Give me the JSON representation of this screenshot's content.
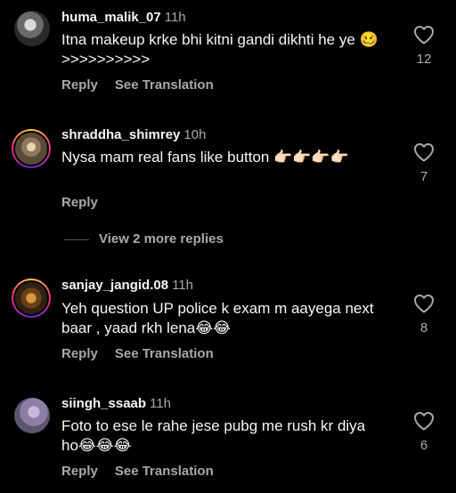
{
  "colors": {
    "background": "#000000",
    "primary_text": "#f5f5f5",
    "secondary_text": "#a8a8a8"
  },
  "comments": [
    {
      "username": "huma_malik_07",
      "time": "11h",
      "text": "Itna makeup krke bhi kitni gandi dikhti he ye 🥴>>>>>>>>>>",
      "likes": "12",
      "reply_label": "Reply",
      "translation_label": "See Translation",
      "avatar_icon": "user-avatar"
    },
    {
      "username": "shraddha_shimrey",
      "time": "10h",
      "text": "Nysa mam real fans like button 👉🏻👉🏻👉🏻👉🏻",
      "likes": "7",
      "reply_label": "Reply",
      "avatar_icon": "user-avatar-story-ring"
    },
    {
      "username": "sanjay_jangid.08",
      "time": "11h",
      "text": "Yeh question UP police k exam m aayega next baar , yaad rkh lena😂😂",
      "likes": "8",
      "reply_label": "Reply",
      "translation_label": "See Translation",
      "avatar_icon": "user-avatar-story-ring"
    },
    {
      "username": "siingh_ssaab",
      "time": "11h",
      "text": "Foto to ese le rahe jese pubg me rush kr diya ho😂😂😂",
      "likes": "6",
      "reply_label": "Reply",
      "translation_label": "See Translation",
      "avatar_icon": "user-avatar"
    }
  ],
  "more_replies_label": "View 2 more replies"
}
